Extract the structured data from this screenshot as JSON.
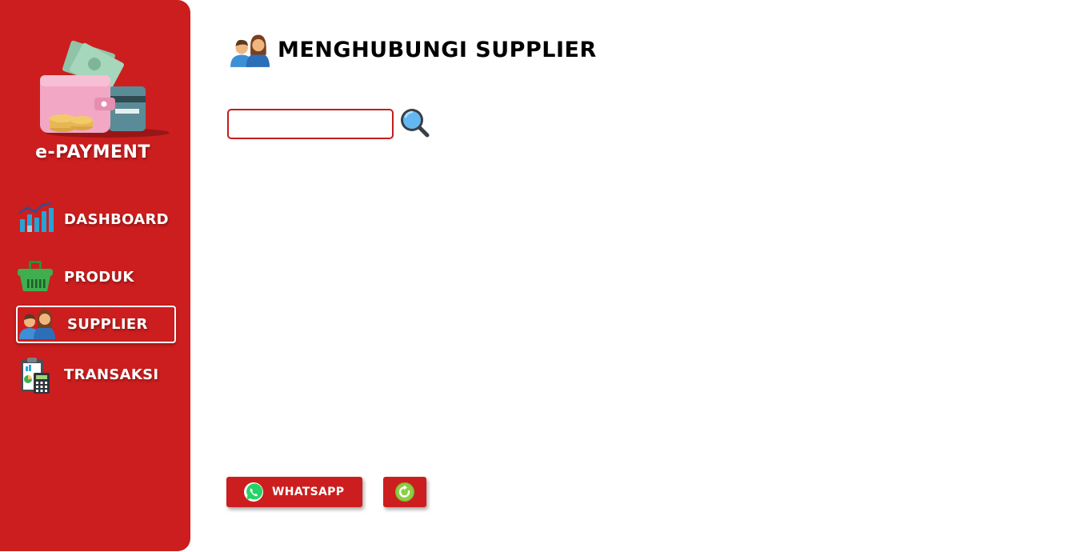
{
  "sidebar": {
    "brand": "e-PAYMENT",
    "items": [
      {
        "label": "DASHBOARD",
        "icon": "bar-chart-icon"
      },
      {
        "label": "PRODUK",
        "icon": "basket-icon"
      },
      {
        "label": "SUPPLIER",
        "icon": "people-icon",
        "active": true
      },
      {
        "label": "TRANSAKSI",
        "icon": "clipboard-calculator-icon"
      }
    ]
  },
  "header": {
    "title": "MENGHUBUNGI SUPPLIER",
    "icon": "people-icon"
  },
  "search": {
    "value": "",
    "icon": "magnifier-icon"
  },
  "actions": {
    "whatsapp_label": "WHATSAPP",
    "whatsapp_icon": "whatsapp-icon",
    "refresh_icon": "refresh-icon"
  },
  "colors": {
    "accent": "#cc1e1e",
    "background": "#ffffff"
  }
}
